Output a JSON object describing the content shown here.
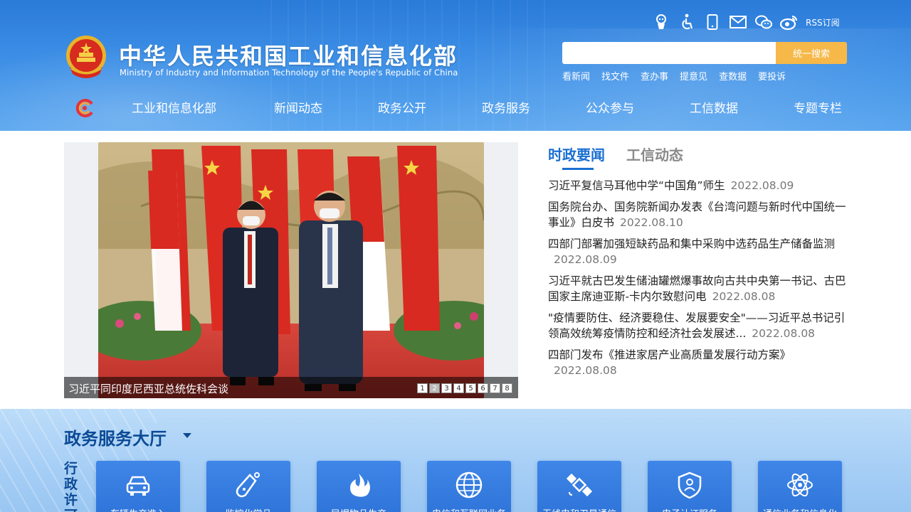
{
  "header": {
    "title_cn": "中华人民共和国工业和信息化部",
    "title_en": "Ministry of Industry and Information Technology of the People's Republic of China",
    "top_icons": [
      "robot-assistant-icon",
      "accessibility-icon",
      "mobile-icon",
      "mail-icon",
      "wechat-icon",
      "weibo-icon"
    ],
    "rss_label": "RSS订阅",
    "search": {
      "placeholder": "",
      "button_label": "统一搜索"
    },
    "quick_links": [
      "看新闻",
      "找文件",
      "查办事",
      "提意见",
      "查数据",
      "要投诉"
    ],
    "nav": [
      "工业和信息化部",
      "新闻动态",
      "政务公开",
      "政务服务",
      "公众参与",
      "工信数据",
      "专题专栏"
    ]
  },
  "slider": {
    "caption": "习近平同印度尼西亚总统佐科会谈",
    "pages": [
      "1",
      "2",
      "3",
      "4",
      "5",
      "6",
      "7",
      "8"
    ],
    "active_page": 2
  },
  "news": {
    "tabs": [
      "时政要闻",
      "工信动态"
    ],
    "active_tab": 0,
    "items": [
      {
        "title": "习近平复信马耳他中学“中国角”师生",
        "date": "2022.08.09"
      },
      {
        "title": "国务院台办、国务院新闻办发表《台湾问题与新时代中国统一事业》白皮书",
        "date": "2022.08.10"
      },
      {
        "title": "四部门部署加强短缺药品和集中采购中选药品生产储备监测",
        "date": "2022.08.09"
      },
      {
        "title": "习近平就古巴发生储油罐燃爆事故向古共中央第一书记、古巴国家主席迪亚斯-卡内尔致慰问电",
        "date": "2022.08.08"
      },
      {
        "title": "\"疫情要防住、经济要稳住、发展要安全\"——习近平总书记引领高效统筹疫情防控和经济社会发展述...",
        "date": "2022.08.08"
      },
      {
        "title": "四部门发布《推进家居产业高质量发展行动方案》",
        "date": "2022.08.08"
      }
    ]
  },
  "service": {
    "title": "政务服务大厅",
    "vertical_label": "行政许可",
    "cards": [
      {
        "icon": "car-icon",
        "label": "车辆生产准入"
      },
      {
        "icon": "chemistry-flask-icon",
        "label": "监控化学品"
      },
      {
        "icon": "fire-icon",
        "label": "民爆物品生产"
      },
      {
        "icon": "globe-icon",
        "label": "电信和互联网业务"
      },
      {
        "icon": "satellite-icon",
        "label": "无线电和卫星通信"
      },
      {
        "icon": "shield-user-icon",
        "label": "电子认证服务"
      },
      {
        "icon": "atom-icon",
        "label": "通信业务和信息化"
      }
    ]
  },
  "colors": {
    "header_blue": "#2a7ad8",
    "search_button": "#f6b849",
    "tab_active": "#1b6fd1",
    "service_title": "#0b4a95",
    "card_blue": "#3f86e8"
  }
}
